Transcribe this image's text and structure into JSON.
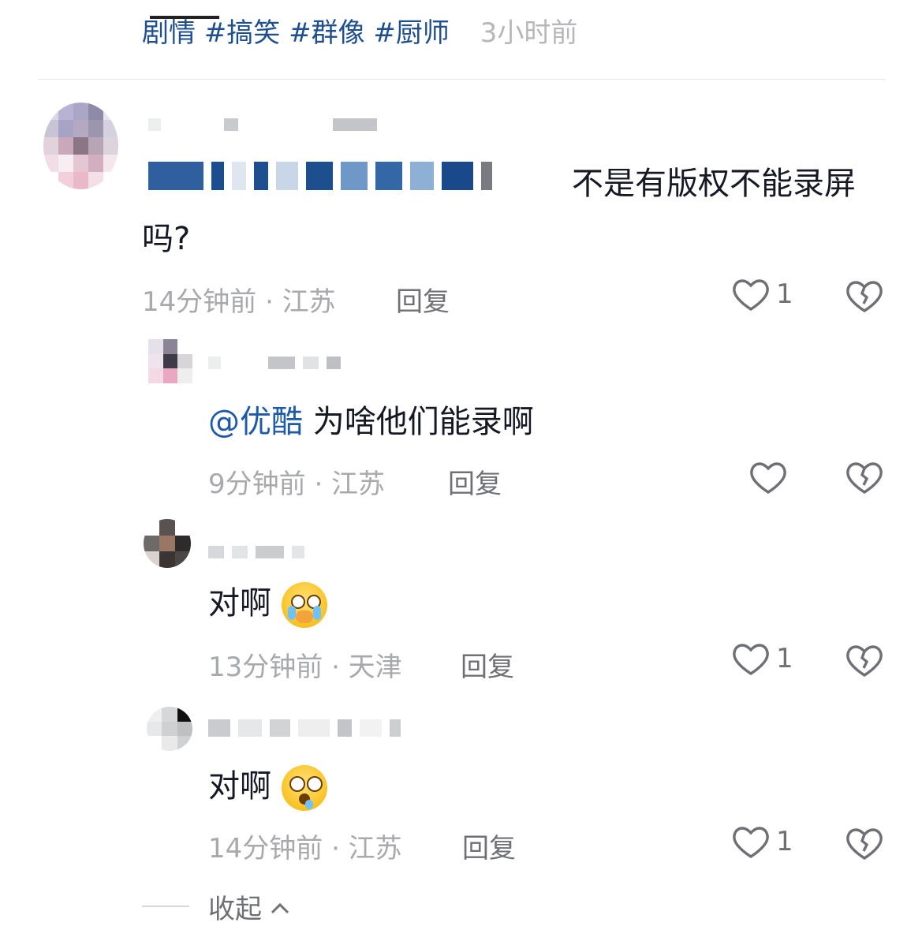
{
  "post": {
    "tags": "剧情 #搞笑 #群像 #厨师",
    "time": "3小时前"
  },
  "comments": [
    {
      "text_visible": "不是有版权不能录屏吗?",
      "time_location": "14分钟前 · 江苏",
      "reply_label": "回复",
      "like_count": "1"
    },
    {
      "mention": "@优酷",
      "text": " 为啥他们能录啊",
      "time_location": "9分钟前 · 江苏",
      "reply_label": "回复",
      "like_count": ""
    },
    {
      "text": "对啊",
      "emoji": "crying-face-emoji",
      "time_location": "13分钟前 · 天津",
      "reply_label": "回复",
      "like_count": "1"
    },
    {
      "text": "对啊",
      "emoji": "drooling-face-emoji",
      "time_location": "14分钟前 · 江苏",
      "reply_label": "回复",
      "like_count": "1"
    }
  ],
  "collapse_label": "收起",
  "colors": {
    "mention": "#1f5aa8",
    "muted": "#a8a9ad",
    "tag": "#1f4f8f"
  }
}
